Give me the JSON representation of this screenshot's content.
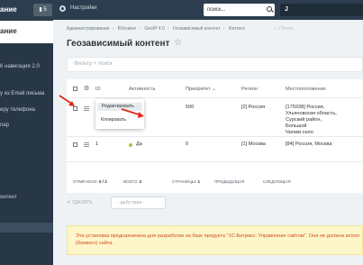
{
  "topbar": {
    "title": "ание",
    "messages_count": "5",
    "settings_label": "Настройки",
    "search_placeholder": "поиск...",
    "user_initial": "J"
  },
  "sidebar": {
    "items": [
      {
        "label": "К навигация 2.0"
      },
      {
        "label": "у из Email письма"
      },
      {
        "label": "еру телефона"
      },
      {
        "label": "пар"
      },
      {
        "label": "онтент"
      }
    ]
  },
  "breadcrumbs": [
    "Администрирование",
    "BXmaker",
    "GeoIP 4.0",
    "Геозависимый контент",
    "Контент"
  ],
  "print_label": "Печать",
  "page_title": "Геозависимый контент",
  "filter_placeholder": "Фильтр + поиск",
  "table": {
    "columns": [
      "ID",
      "Активность",
      "Приоритет",
      "Регион",
      "Местоположение"
    ],
    "sort_indicator": "⌄",
    "rows": [
      {
        "id": "",
        "active": "",
        "priority": "500",
        "region": "[2] Россия",
        "location": [
          "[175938] Россия,",
          "Ульяновская область,",
          "Сурский район,",
          "Большой",
          "Чилим село"
        ]
      },
      {
        "id": "1",
        "active": "Да",
        "priority": "0",
        "region": "[1] Москва",
        "location": [
          "[84] Россия, Москва"
        ]
      }
    ]
  },
  "footer": {
    "selected_label": "ОТМЕЧЕНО:",
    "selected_value": "0 / 2",
    "total_label": "ВСЕГО:",
    "total_value": "2",
    "pages_label": "СТРАНИЦЫ:",
    "pages_value": "1",
    "prev_label": "ПРЕДЫДУЩАЯ",
    "next_label": "СЛЕДУЮЩАЯ"
  },
  "actions": {
    "delete_label": "✕ УДАЛИТЬ",
    "select_label": "- действия -"
  },
  "context_menu": {
    "items": [
      "Редактировать",
      "Копировать"
    ]
  },
  "notice": "Эта установка предназначена для разработки на базе продукта \"1С-Битрикс: Управление сайтом\". Она не должна испол (боевого) сайта.",
  "colors": {
    "topbar": "#2b3d4e",
    "sidebar": "#283746",
    "active_dot": "#a7c930",
    "notice_text": "#d14b26",
    "notice_bg": "#fdf6c8",
    "arrow": "#e0281c"
  }
}
